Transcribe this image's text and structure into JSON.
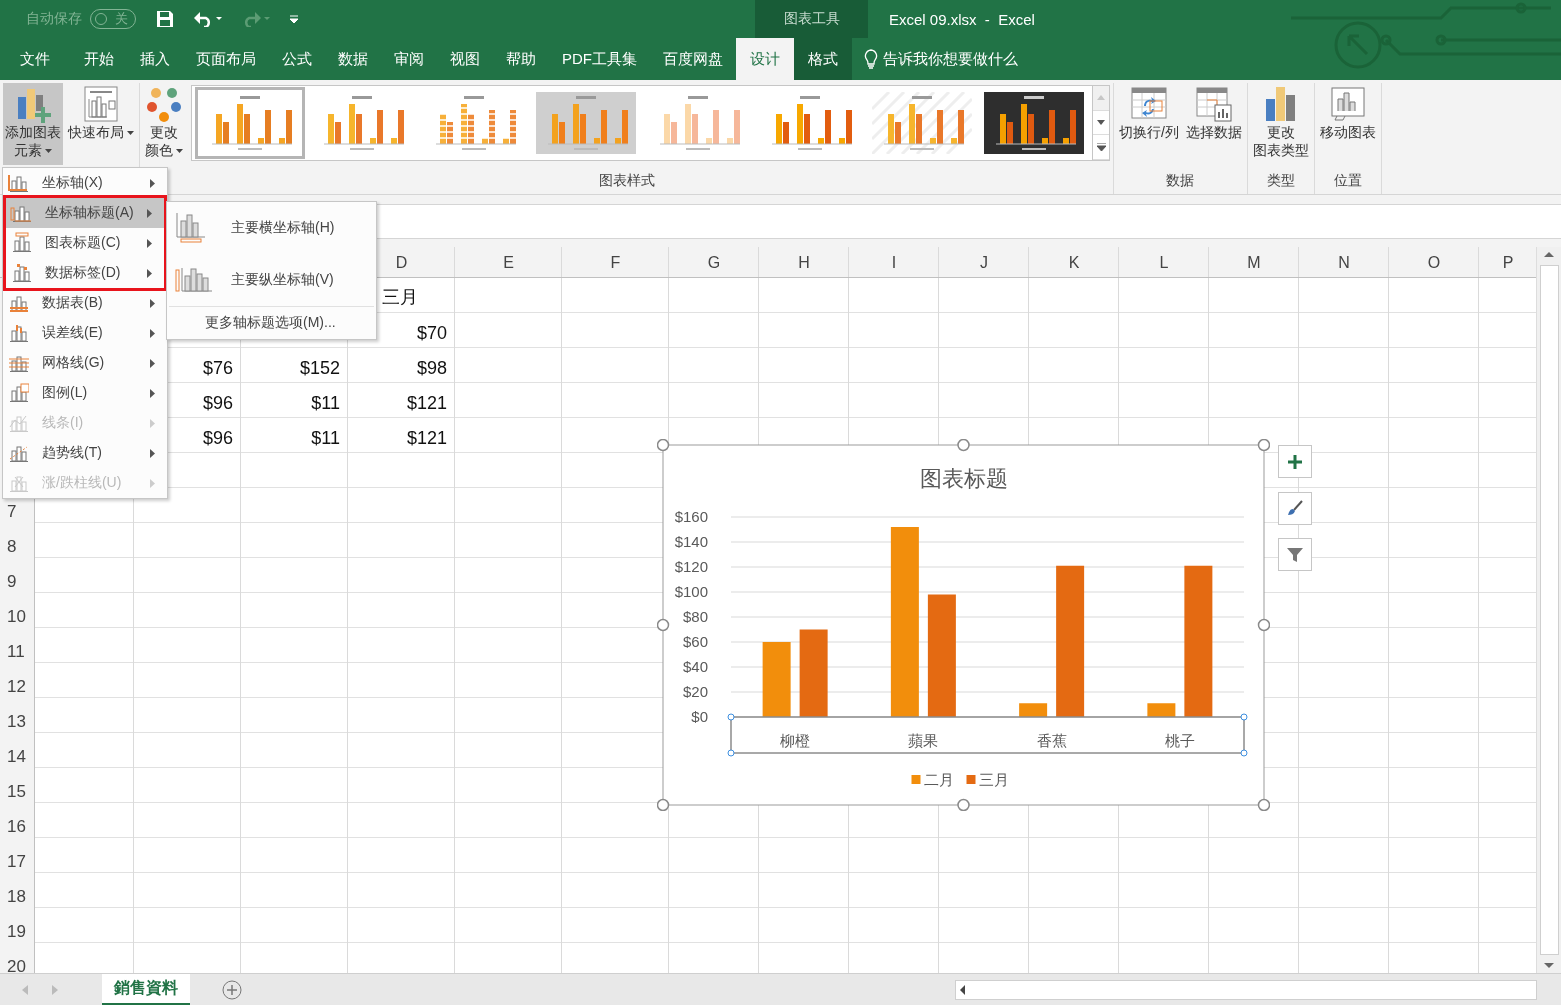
{
  "title_bar": {
    "autosave": {
      "label": "自动保存",
      "on": false,
      "state_text": "关"
    },
    "redo_disabled": true,
    "context_label": "图表工具",
    "title": "Excel 09.xlsx  -  Excel"
  },
  "tabs": [
    {
      "label": "文件",
      "selected": false,
      "kind": "file"
    },
    {
      "label": "开始",
      "selected": false,
      "kind": "normal"
    },
    {
      "label": "插入",
      "selected": false,
      "kind": "normal"
    },
    {
      "label": "页面布局",
      "selected": false,
      "kind": "normal"
    },
    {
      "label": "公式",
      "selected": false,
      "kind": "normal"
    },
    {
      "label": "数据",
      "selected": false,
      "kind": "normal"
    },
    {
      "label": "审阅",
      "selected": false,
      "kind": "normal"
    },
    {
      "label": "视图",
      "selected": false,
      "kind": "normal"
    },
    {
      "label": "帮助",
      "selected": false,
      "kind": "normal"
    },
    {
      "label": "PDF工具集",
      "selected": false,
      "kind": "normal"
    },
    {
      "label": "百度网盘",
      "selected": false,
      "kind": "normal"
    },
    {
      "label": "设计",
      "selected": true,
      "kind": "context"
    },
    {
      "label": "格式",
      "selected": false,
      "kind": "context"
    }
  ],
  "tell_me": "告诉我你想要做什么",
  "ribbon": {
    "groups": [
      {
        "kind": "buttons",
        "buttons": [
          {
            "lines": [
              "添加图表",
              "元素"
            ],
            "kind": "add",
            "pressed": true,
            "dropdown": true
          },
          {
            "lines": [
              "快速布局"
            ],
            "kind": "layout",
            "pressed": false,
            "dropdown": true
          }
        ]
      },
      {
        "kind": "gallery",
        "label": "图表样式",
        "buttons": [
          {
            "lines": [
              "更改",
              "颜色"
            ],
            "kind": "colors",
            "pressed": false,
            "dropdown": true
          }
        ],
        "thumbnails": [
          {
            "kind": "plain",
            "selected": true
          },
          {
            "kind": "labeled",
            "selected": false
          },
          {
            "kind": "blocks",
            "selected": false
          },
          {
            "kind": "gray",
            "selected": false
          },
          {
            "kind": "pale",
            "selected": false
          },
          {
            "kind": "shaded",
            "selected": false
          },
          {
            "kind": "hatched",
            "selected": false
          },
          {
            "kind": "dark",
            "selected": false
          }
        ],
        "scroll_up_disabled": true
      },
      {
        "kind": "buttons",
        "label": "数据",
        "buttons": [
          {
            "lines": [
              "切换行/列"
            ],
            "kind": "switch",
            "pressed": false,
            "dropdown": false
          },
          {
            "lines": [
              "选择数据"
            ],
            "kind": "select",
            "pressed": false,
            "dropdown": false
          }
        ]
      },
      {
        "kind": "buttons",
        "label": "类型",
        "buttons": [
          {
            "lines": [
              "更改",
              "图表类型"
            ],
            "kind": "type",
            "pressed": false,
            "dropdown": false
          }
        ]
      },
      {
        "kind": "buttons",
        "label": "位置",
        "buttons": [
          {
            "lines": [
              "移动图表"
            ],
            "kind": "move",
            "pressed": false,
            "dropdown": false
          }
        ]
      }
    ]
  },
  "sheet": {
    "column_headers": [
      "D",
      "E",
      "F",
      "G",
      "H",
      "I",
      "J",
      "K",
      "L",
      "M",
      "N",
      "O",
      "P"
    ],
    "row_numbers": [
      "7",
      "8",
      "9",
      "10",
      "11",
      "12",
      "13",
      "14",
      "15",
      "16",
      "17",
      "18",
      "19",
      "20"
    ],
    "rows": [
      {
        "cells": [
          {},
          {},
          {},
          {
            "value": "三月",
            "kind": "text"
          }
        ]
      },
      {
        "cells": [
          {},
          {},
          {},
          {
            "value": "$70",
            "kind": "number"
          }
        ]
      },
      {
        "cells": [
          {},
          {
            "value": "$76",
            "kind": "number"
          },
          {
            "value": "$152",
            "kind": "number"
          },
          {
            "value": "$98",
            "kind": "number"
          }
        ]
      },
      {
        "cells": [
          {},
          {
            "value": "$96",
            "kind": "number"
          },
          {
            "value": "$11",
            "kind": "number"
          },
          {
            "value": "$121",
            "kind": "number"
          }
        ]
      },
      {
        "cells": [
          {},
          {
            "value": "$96",
            "kind": "number"
          },
          {
            "value": "$11",
            "kind": "number"
          },
          {
            "value": "$121",
            "kind": "number"
          }
        ]
      }
    ]
  },
  "menu": {
    "items": [
      {
        "label": "坐标轴(X)",
        "kind": "axes",
        "selected": false,
        "disabled": false,
        "outlined": false
      },
      {
        "label": "坐标轴标题(A)",
        "kind": "axistitles",
        "selected": true,
        "disabled": false,
        "outlined": true
      },
      {
        "label": "图表标题(C)",
        "kind": "charttitle",
        "selected": false,
        "disabled": false,
        "outlined": true
      },
      {
        "label": "数据标签(D)",
        "kind": "datalabels",
        "selected": false,
        "disabled": false,
        "outlined": true
      },
      {
        "label": "数据表(B)",
        "kind": "datatable",
        "selected": false,
        "disabled": false,
        "outlined": false
      },
      {
        "label": "误差线(E)",
        "kind": "errorbars",
        "selected": false,
        "disabled": false,
        "outlined": false
      },
      {
        "label": "网格线(G)",
        "kind": "gridlines",
        "selected": false,
        "disabled": false,
        "outlined": false
      },
      {
        "label": "图例(L)",
        "kind": "legend",
        "selected": false,
        "disabled": false,
        "outlined": false
      },
      {
        "label": "线条(I)",
        "kind": "lines",
        "selected": false,
        "disabled": true,
        "outlined": false
      },
      {
        "label": "趋势线(T)",
        "kind": "trendline",
        "selected": false,
        "disabled": false,
        "outlined": false
      },
      {
        "label": "涨/跌柱线(U)",
        "kind": "updown",
        "selected": false,
        "disabled": true,
        "outlined": false
      }
    ]
  },
  "submenu": {
    "items": [
      {
        "label": "主要横坐标轴(H)",
        "kind": "horizontal"
      },
      {
        "label": "主要纵坐标轴(V)",
        "kind": "vertical"
      }
    ],
    "more": "更多轴标题选项(M)..."
  },
  "chart": {
    "selected": true,
    "axis_selected": true,
    "chart_data": {
      "type": "bar",
      "title": "图表标题",
      "categories": [
        "柳橙",
        "蘋果",
        "香蕉",
        "桃子"
      ],
      "series": [
        {
          "name": "二月",
          "color": "#f28e0c",
          "values": [
            60,
            152,
            11,
            11
          ]
        },
        {
          "name": "三月",
          "color": "#e46a12",
          "values": [
            70,
            98,
            121,
            121
          ]
        }
      ],
      "ylim": [
        0,
        160
      ],
      "grid": true,
      "legend": true,
      "yticks": [
        {
          "value": 0,
          "label": "$0"
        },
        {
          "value": 20,
          "label": "$20"
        },
        {
          "value": 40,
          "label": "$40"
        },
        {
          "value": 60,
          "label": "$60"
        },
        {
          "value": 80,
          "label": "$80"
        },
        {
          "value": 100,
          "label": "$100"
        },
        {
          "value": 120,
          "label": "$120"
        },
        {
          "value": 140,
          "label": "$140"
        },
        {
          "value": 160,
          "label": "$160"
        }
      ]
    },
    "side_buttons": [
      {
        "kind": "plus"
      },
      {
        "kind": "brush"
      },
      {
        "kind": "filter"
      }
    ]
  },
  "sheet_tabs": [
    {
      "label": "銷售資料",
      "selected": true
    }
  ]
}
